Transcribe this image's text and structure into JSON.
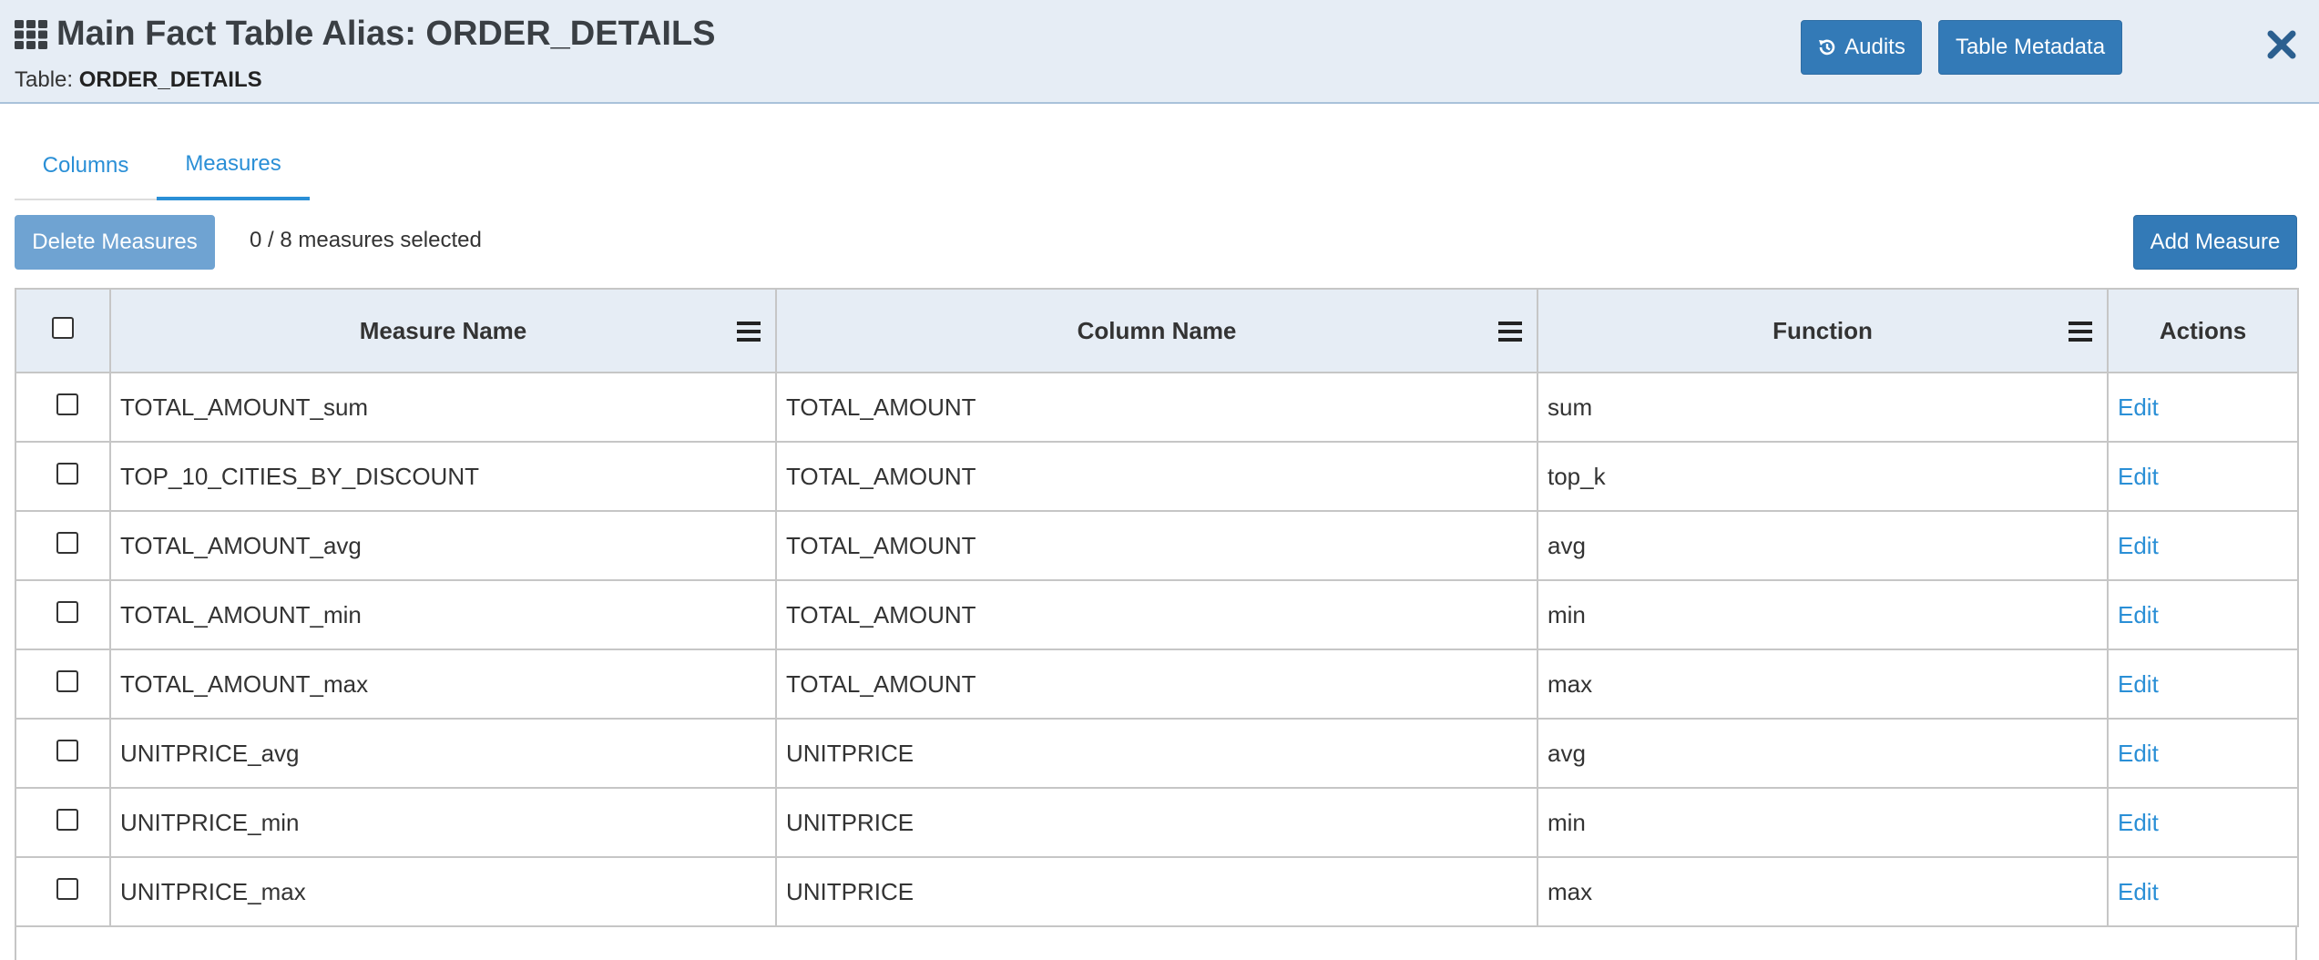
{
  "header": {
    "title": "Main Fact Table Alias: ORDER_DETAILS",
    "table_label": "Table:",
    "table_name": "ORDER_DETAILS",
    "audits_label": "Audits",
    "metadata_label": "Table Metadata"
  },
  "tabs": [
    {
      "label": "Columns",
      "active": false
    },
    {
      "label": "Measures",
      "active": true
    }
  ],
  "toolbar": {
    "delete_label": "Delete Measures",
    "selection_text": "0 / 8 measures selected",
    "add_label": "Add Measure"
  },
  "table": {
    "headers": [
      "Measure Name",
      "Column Name",
      "Function",
      "Actions"
    ],
    "rows": [
      {
        "measure": "TOTAL_AMOUNT_sum",
        "column": "TOTAL_AMOUNT",
        "function": "sum",
        "action": "Edit"
      },
      {
        "measure": "TOP_10_CITIES_BY_DISCOUNT",
        "column": "TOTAL_AMOUNT",
        "function": "top_k",
        "action": "Edit"
      },
      {
        "measure": "TOTAL_AMOUNT_avg",
        "column": "TOTAL_AMOUNT",
        "function": "avg",
        "action": "Edit"
      },
      {
        "measure": "TOTAL_AMOUNT_min",
        "column": "TOTAL_AMOUNT",
        "function": "min",
        "action": "Edit"
      },
      {
        "measure": "TOTAL_AMOUNT_max",
        "column": "TOTAL_AMOUNT",
        "function": "max",
        "action": "Edit"
      },
      {
        "measure": "UNITPRICE_avg",
        "column": "UNITPRICE",
        "function": "avg",
        "action": "Edit"
      },
      {
        "measure": "UNITPRICE_min",
        "column": "UNITPRICE",
        "function": "min",
        "action": "Edit"
      },
      {
        "measure": "UNITPRICE_max",
        "column": "UNITPRICE",
        "function": "max",
        "action": "Edit"
      }
    ]
  },
  "colors": {
    "primary": "#337ab7",
    "link": "#2a8fd6",
    "header_bg": "#e6edf5"
  },
  "icons": {
    "title": "grid-icon",
    "audits": "history-icon",
    "close": "close-icon",
    "column_menu": "column-menu-icon"
  }
}
